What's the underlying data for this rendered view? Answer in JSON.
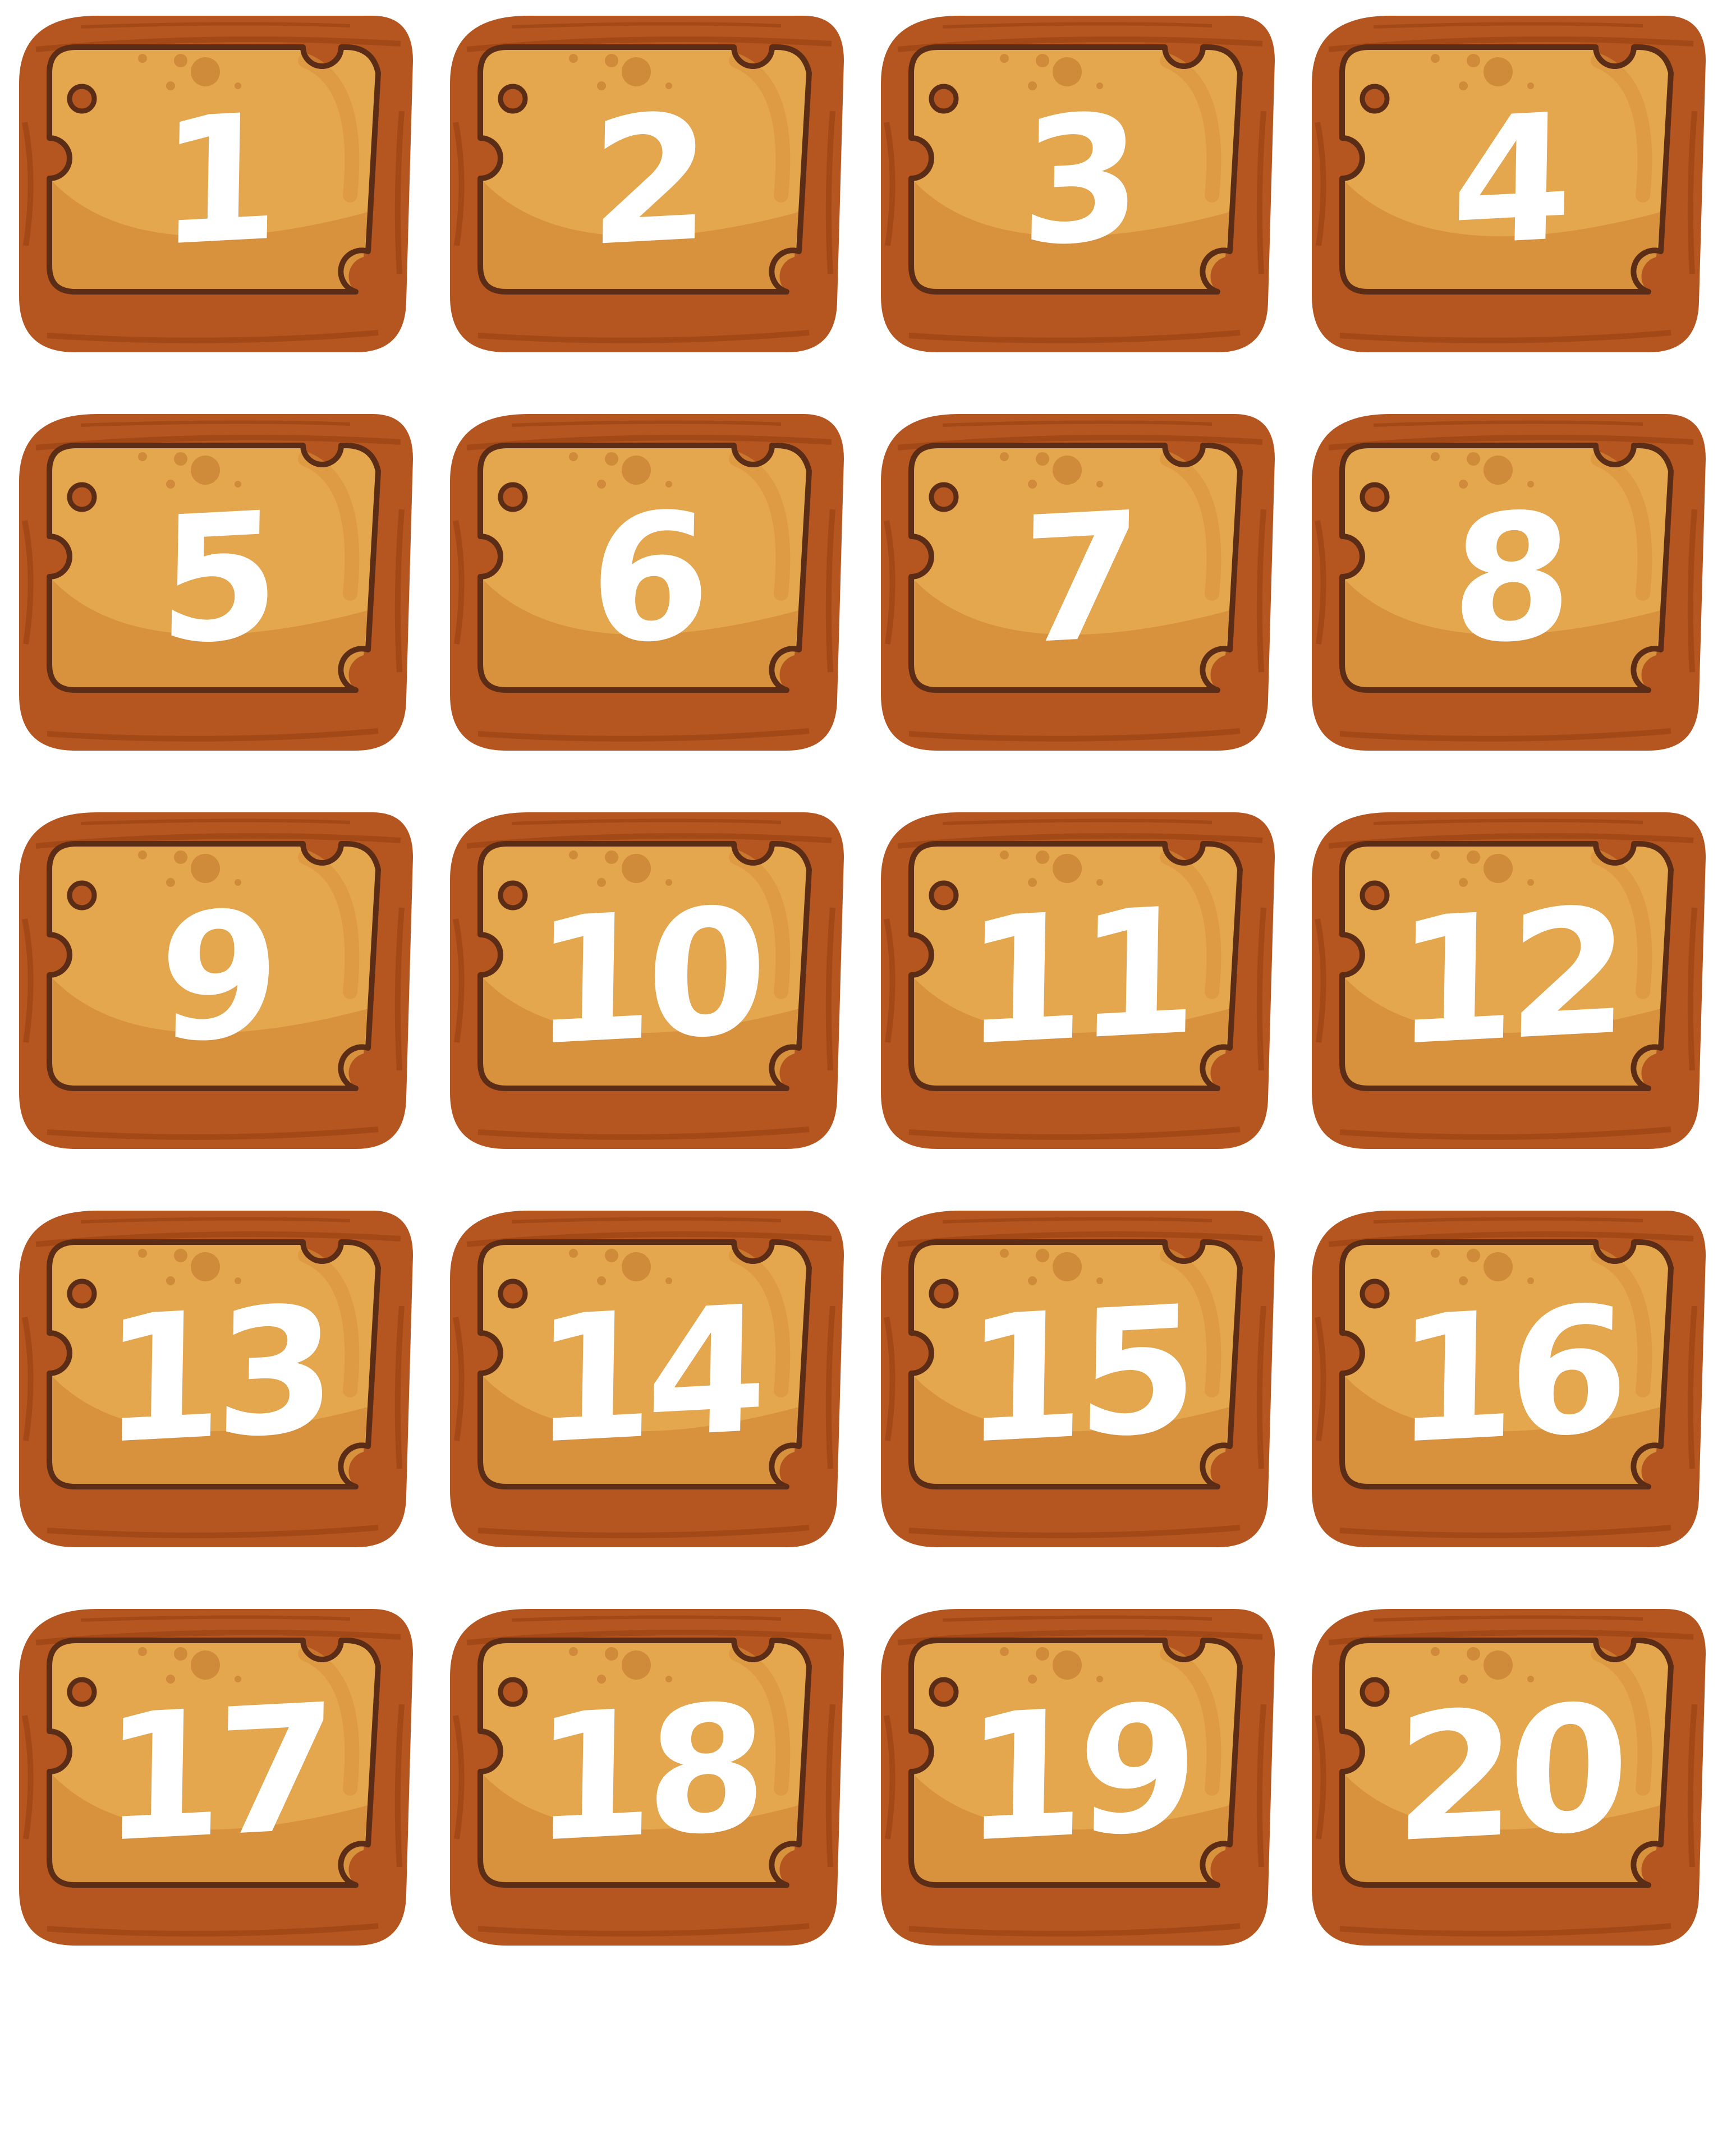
{
  "colors": {
    "frame_outer": "#B5551F",
    "frame_stripe": "#A34817",
    "frame_highlight": "#C8692D",
    "inner_outline": "#5C2D16",
    "plate_light": "#E5A74E",
    "plate_dark": "#D8913C",
    "plate_dot": "#CF8A3A",
    "digit": "#FFFFFF",
    "background": "#FFFFFF"
  },
  "icons": {
    "frame": "wooden-plaque-frame",
    "hole": "screw-hole-icon",
    "notch": "corner-notch"
  },
  "tiles": [
    {
      "label": "1"
    },
    {
      "label": "2"
    },
    {
      "label": "3"
    },
    {
      "label": "4"
    },
    {
      "label": "5"
    },
    {
      "label": "6"
    },
    {
      "label": "7"
    },
    {
      "label": "8"
    },
    {
      "label": "9"
    },
    {
      "label": "10"
    },
    {
      "label": "11"
    },
    {
      "label": "12"
    },
    {
      "label": "13"
    },
    {
      "label": "14"
    },
    {
      "label": "15"
    },
    {
      "label": "16"
    },
    {
      "label": "17"
    },
    {
      "label": "18"
    },
    {
      "label": "19"
    },
    {
      "label": "20"
    }
  ]
}
